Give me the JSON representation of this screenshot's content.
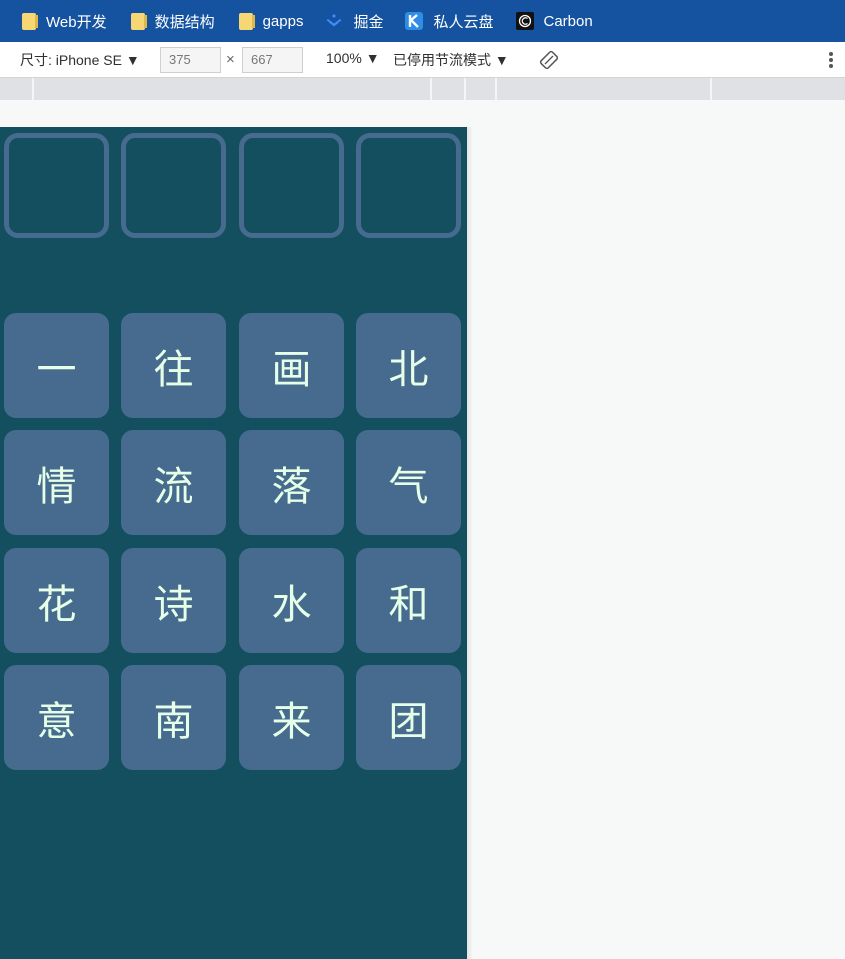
{
  "bookmarks": [
    {
      "label": "Web开发",
      "icon": "folder-icon"
    },
    {
      "label": "数据结构",
      "icon": "folder-icon"
    },
    {
      "label": "gapps",
      "icon": "folder-icon"
    },
    {
      "label": "掘金",
      "icon": "juejin-icon"
    },
    {
      "label": "私人云盘",
      "icon": "kodbox-icon"
    },
    {
      "label": "Carbon",
      "icon": "carbon-icon"
    }
  ],
  "devtools": {
    "device_select": "尺寸: iPhone SE ▼",
    "width_value": "375",
    "height_value": "667",
    "times_symbol": "×",
    "zoom": "100% ▼",
    "throttling": "已停用节流模式 ▼",
    "rotate_icon": "rotate-icon",
    "more_icon": "more-vertical-icon"
  },
  "game": {
    "answer_slots": [
      "",
      "",
      "",
      ""
    ],
    "tiles": [
      "一",
      "往",
      "画",
      "北",
      "情",
      "流",
      "落",
      "气",
      "花",
      "诗",
      "水",
      "和",
      "意",
      "南",
      "来",
      "团"
    ]
  },
  "colors": {
    "bookmark_bar": "#1553a0",
    "viewport_bg": "#134f5f",
    "tile_bg": "#476b8e",
    "tile_text": "#e6ffe8"
  }
}
